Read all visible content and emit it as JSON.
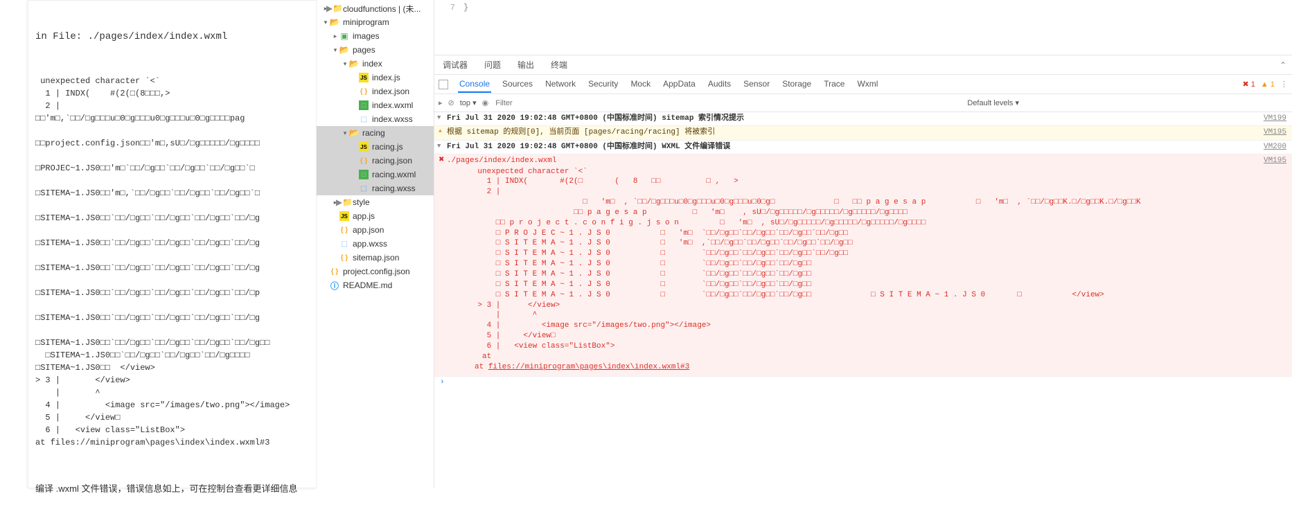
{
  "leftPanel": {
    "title": "in File: ./pages/index/index.wxml",
    "errorText": " unexpected character `<`\n  1 | INDX(    #(2(□(8□□□,>\n  2 |\n□□'m□,`□□/□g□□□u□0□g□□□u0□g□□□u□0□g□□□□pag\n\n□□project.config.json□□'m□,sU□/□g□□□□□/□g□□□□\n\n□PROJEC~1.JS0□□'m□`□□/□g□□`□□/□g□□`□□/□g□□`□\n\n□SITEMA~1.JS0□□'m□,`□□/□g□□`□□/□g□□`□□/□g□□`□\n\n□SITEMA~1.JS0□□`□□/□g□□`□□/□g□□`□□/□g□□`□□/□g\n\n□SITEMA~1.JS0□□`□□/□g□□`□□/□g□□`□□/□g□□`□□/□g\n\n□SITEMA~1.JS0□□`□□/□g□□`□□/□g□□`□□/□g□□`□□/□g\n\n□SITEMA~1.JS0□□`□□/□g□□`□□/□g□□`□□/□g□□`□□/□p\n\n□SITEMA~1.JS0□□`□□/□g□□`□□/□g□□`□□/□g□□`□□/□g\n\n□SITEMA~1.JS0□□`□□/□g□□`□□/□g□□`□□/□g□□`□□/□g□□\n  □SITEMA~1.JS0□□`□□/□g□□`□□/□g□□`□□/□g□□□□\n□SITEMA~1.JS0□□  </view>\n> 3 |       </view>\n    |       ^\n  4 |         <image src=\"/images/two.png\"></image>\n  5 |     </view□\n  6 |   <view class=\"ListBox\">\nat files://miniprogram\\pages\\index\\index.wxml#3",
    "summary": "编译 .wxml 文件错误，错误信息如上，可在控制台查看更详细信息"
  },
  "tree": [
    {
      "depth": 0,
      "arrow": "▸",
      "icon": "folder",
      "label": "cloudfunctions | (未..."
    },
    {
      "depth": 0,
      "arrow": "▾",
      "icon": "folder-open",
      "label": "miniprogram"
    },
    {
      "depth": 1,
      "arrow": "▸",
      "icon": "img",
      "label": "images"
    },
    {
      "depth": 1,
      "arrow": "▾",
      "icon": "folder-open",
      "label": "pages"
    },
    {
      "depth": 2,
      "arrow": "▾",
      "icon": "folder-open",
      "label": "index"
    },
    {
      "depth": 3,
      "arrow": "",
      "icon": "js",
      "label": "index.js"
    },
    {
      "depth": 3,
      "arrow": "",
      "icon": "json",
      "label": "index.json"
    },
    {
      "depth": 3,
      "arrow": "",
      "icon": "wxml",
      "label": "index.wxml"
    },
    {
      "depth": 3,
      "arrow": "",
      "icon": "wxss",
      "label": "index.wxss"
    },
    {
      "depth": 2,
      "arrow": "▾",
      "icon": "folder-open",
      "label": "racing",
      "selected": true
    },
    {
      "depth": 3,
      "arrow": "",
      "icon": "js",
      "label": "racing.js",
      "selected": true
    },
    {
      "depth": 3,
      "arrow": "",
      "icon": "json",
      "label": "racing.json",
      "selected": true
    },
    {
      "depth": 3,
      "arrow": "",
      "icon": "wxml",
      "label": "racing.wxml",
      "selected": true
    },
    {
      "depth": 3,
      "arrow": "",
      "icon": "wxss",
      "label": "racing.wxss",
      "selected": true
    },
    {
      "depth": 1,
      "arrow": "▸",
      "icon": "folder",
      "label": "style"
    },
    {
      "depth": 1,
      "arrow": "",
      "icon": "js",
      "label": "app.js"
    },
    {
      "depth": 1,
      "arrow": "",
      "icon": "json",
      "label": "app.json"
    },
    {
      "depth": 1,
      "arrow": "",
      "icon": "wxss",
      "label": "app.wxss"
    },
    {
      "depth": 1,
      "arrow": "",
      "icon": "json",
      "label": "sitemap.json"
    },
    {
      "depth": 0,
      "arrow": "",
      "icon": "json",
      "label": "project.config.json"
    },
    {
      "depth": 0,
      "arrow": "",
      "icon": "md",
      "label": "README.md"
    }
  ],
  "editor": {
    "line": "7",
    "content": "}"
  },
  "topTabs": [
    "调试器",
    "问题",
    "输出",
    "终端"
  ],
  "devtoolsTabs": [
    "Console",
    "Sources",
    "Network",
    "Security",
    "Mock",
    "AppData",
    "Audits",
    "Sensor",
    "Storage",
    "Trace",
    "Wxml"
  ],
  "devtoolsActive": "Console",
  "statusErr": "1",
  "statusWarn": "1",
  "consoleToolbar": {
    "top": "top",
    "eye": "◉",
    "filterPlaceholder": "Filter",
    "levels": "Default levels ▾"
  },
  "logs": {
    "ts1": "Fri Jul 31 2020 19:02:48 GMT+0800 (中国标准时间) sitemap 索引情况提示",
    "vm1": "VM199",
    "warn": "根据 sitemap 的规则[0], 当前页面 [pages/racing/racing] 将被索引",
    "vm2": "VM195",
    "ts2": "Fri Jul 31 2020 19:02:48 GMT+0800 (中国标准时间)  WXML 文件编译错误",
    "vm3": "VM200",
    "errFile": "./pages/index/index.wxml",
    "vm4": "VM195",
    "errBody": "    unexpected character `<`\n      1 | INDX(       #(2(□       (   8   □□          □ ,   >\n      2 |\n                           □   'm□  , `□□/□g□□□u□0□g□□□u□0□g□□□u□0□g□             □   □□ p a g e s a p           □   'm□  , `□□/□g□□K.□/□g□□K.□/□g□□K\n                         □□ p a g e s a p          □   'm□    , sU□/□g□□□□□/□g□□□□□/□g□□□□□/□g□□□□\n        □□ p r o j e c t . c o n f i g . j s o n         □   'm□  , sU□/□g□□□□□/□g□□□□□/□g□□□□□/□g□□□□\n        □ P R O J E C ~ 1 . J S 0           □   'm□  `□□/□g□□`□□/□g□□`□□/□g□□`□□/□g□□\n        □ S I T E M A ~ 1 . J S 0           □   'm□  ,`□□/□g□□`□□/□g□□`□□/□g□□`□□/□g□□\n        □ S I T E M A ~ 1 . J S 0           □        `□□/□g□□`□□/□g□□`□□/□g□□`□□/□g□□\n        □ S I T E M A ~ 1 . J S 0           □        `□□/□g□□`□□/□g□□`□□/□g□□\n        □ S I T E M A ~ 1 . J S 0           □        `□□/□g□□`□□/□g□□`□□/□g□□\n        □ S I T E M A ~ 1 . J S 0           □        `□□/□g□□`□□/□g□□`□□/□g□□\n        □ S I T E M A ~ 1 . J S 0           □        `□□/□g□□`□□/□g□□`□□/□g□□             □ S I T E M A ~ 1 . J S 0       □           </view>\n    > 3 |      </view>\n        |       ^\n      4 |         <image src=\"/images/two.png\"></image>\n      5 |     </view□\n      6 |   <view class=\"ListBox\">\n     at ",
    "errLink": "files://miniprogram\\pages\\index\\index.wxml#3"
  }
}
